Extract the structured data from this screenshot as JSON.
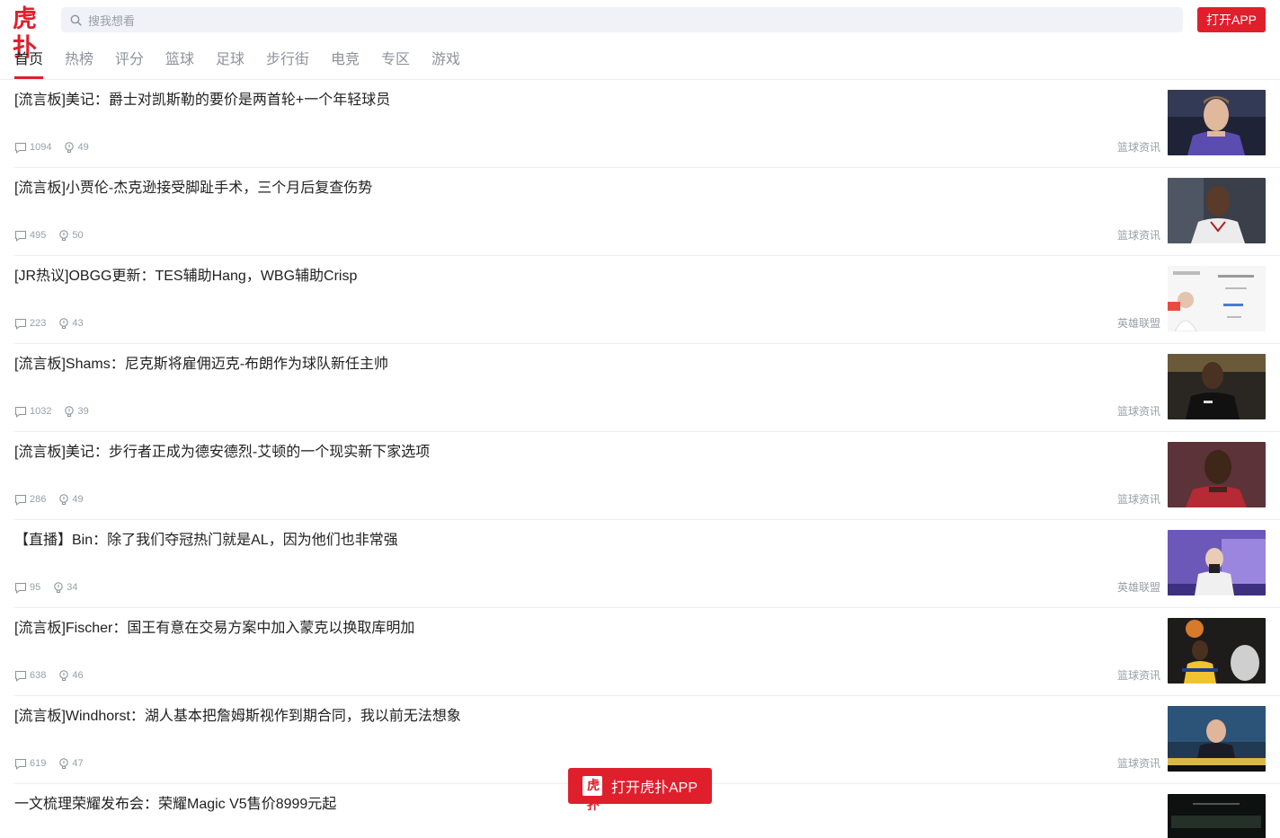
{
  "header": {
    "logo_text": "虎扑",
    "search_placeholder": "搜我想看",
    "open_app_label": "打开APP"
  },
  "nav": {
    "tabs": [
      "首页",
      "热榜",
      "评分",
      "篮球",
      "足球",
      "步行街",
      "电竞",
      "专区",
      "游戏"
    ],
    "active_index": 0
  },
  "feed": [
    {
      "title": "[流言板]美记：爵士对凯斯勒的要价是两首轮+一个年轻球员",
      "comments": "1094",
      "likes": "49",
      "category": "篮球资讯",
      "thumb": "player-purple-jersey"
    },
    {
      "title": "[流言板]小贾伦-杰克逊接受脚趾手术，三个月后复查伤势",
      "comments": "495",
      "likes": "50",
      "category": "篮球资讯",
      "thumb": "player-white-jersey"
    },
    {
      "title": "[JR热议]OBGG更新：TES辅助Hang，WBG辅助Crisp",
      "comments": "223",
      "likes": "43",
      "category": "英雄联盟",
      "thumb": "esports-card"
    },
    {
      "title": "[流言板]Shams：尼克斯将雇佣迈克-布朗作为球队新任主帅",
      "comments": "1032",
      "likes": "39",
      "category": "篮球资讯",
      "thumb": "coach-black-shirt"
    },
    {
      "title": "[流言板]美记：步行者正成为德安德烈-艾顿的一个现实新下家选项",
      "comments": "286",
      "likes": "49",
      "category": "篮球资讯",
      "thumb": "player-red-jersey"
    },
    {
      "title": "【直播】Bin：除了我们夺冠热门就是AL，因为他们也非常强",
      "comments": "95",
      "likes": "34",
      "category": "英雄联盟",
      "thumb": "esports-interview"
    },
    {
      "title": "[流言板]Fischer：国王有意在交易方案中加入蒙克以换取库明加",
      "comments": "638",
      "likes": "46",
      "category": "篮球资讯",
      "thumb": "player-shooting"
    },
    {
      "title": "[流言板]Windhorst：湖人基本把詹姆斯视作到期合同，我以前无法想象",
      "comments": "619",
      "likes": "47",
      "category": "篮球资讯",
      "thumb": "tv-studio"
    },
    {
      "title": "一文梳理荣耀发布会：荣耀Magic V5售价8999元起",
      "comments": "",
      "likes": "",
      "category": "",
      "thumb": "phone-launch"
    }
  ],
  "float_button": {
    "logo_text": "虎扑",
    "label": "打开虎扑APP"
  }
}
